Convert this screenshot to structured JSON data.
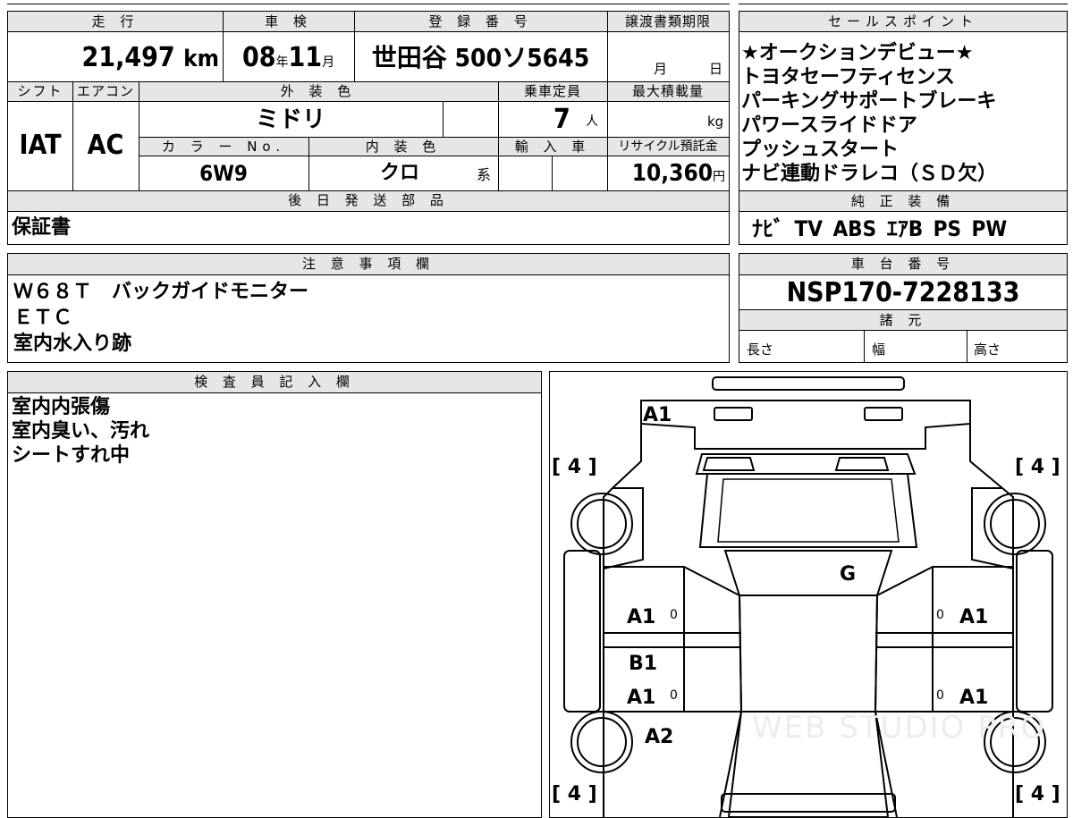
{
  "headers": {
    "mileage": "走 行",
    "inspection": "車 検",
    "registration": "登 録 番 号",
    "transfer": "譲渡書類期限",
    "sales_points": "セールスポイント",
    "shift": "シフト",
    "aircon": "エアコン",
    "exterior_color": "外 装 色",
    "capacity": "乗車定員",
    "max_load": "最大積載量",
    "color_no": "カ ラ ー No.",
    "interior_color": "内 装 色",
    "import": "輸 入 車",
    "recycle": "リサイクル預託金",
    "parts_later": "後 日 発 送 部 品",
    "genuine_equipment": "純 正 装 備",
    "notes": "注 意 事 項 欄",
    "chassis_number": "車 台 番 号",
    "specs": "諸 元",
    "inspector": "検 査 員 記 入 欄"
  },
  "vehicle": {
    "mileage": "21,497",
    "mileage_unit": "km",
    "inspection_year": "08",
    "year_unit": "年",
    "inspection_month": "11",
    "month_unit": "月",
    "registration_number": "世田谷 500ソ5645",
    "transfer_month_unit": "月",
    "transfer_day_unit": "日",
    "shift": "IAT",
    "aircon": "AC",
    "exterior_color": "ミドリ",
    "capacity": "7",
    "capacity_unit": "人",
    "load_unit": "kg",
    "color_no": "6W9",
    "interior_color": "クロ",
    "interior_suffix": "系",
    "recycle_fee": "10,360",
    "recycle_unit": "円",
    "parts_later": "保証書",
    "chassis_number": "NSP170-7228133",
    "spec_length": "長さ",
    "spec_width": "幅",
    "spec_height": "高さ"
  },
  "sales_points": [
    "★オークションデビュー★",
    "トヨタセーフティセンス",
    "パーキングサポートブレーキ",
    "パワースライドドア",
    "プッシュスタート",
    "ナビ連動ドラレコ（ＳＤ欠）"
  ],
  "equipment": "ﾅﾋﾞ TV ABS ｴｱB PS PW",
  "notes": [
    "Ｗ６８Ｔ　バックガイドモニター",
    "ＥＴＣ",
    "室内水入り跡"
  ],
  "inspector_notes": [
    "室内内張傷",
    "室内臭い、汚れ",
    "シートすれ中"
  ],
  "diagram": {
    "rear_mark": "A1",
    "glass_mark": "G",
    "left_front_door": "A1",
    "left_pillar": "B1",
    "left_rear_door": "A1",
    "left_rear_fender": "A2",
    "right_front_door": "A1",
    "right_rear_door": "A1",
    "tire_marks": [
      "[ 4 ]",
      "[ 4 ]",
      "[ 4 ]",
      "[ 4 ]"
    ],
    "zero_marks": [
      "0",
      "0",
      "0",
      "0"
    ],
    "watermark": "WEB STUDIO PRO"
  }
}
